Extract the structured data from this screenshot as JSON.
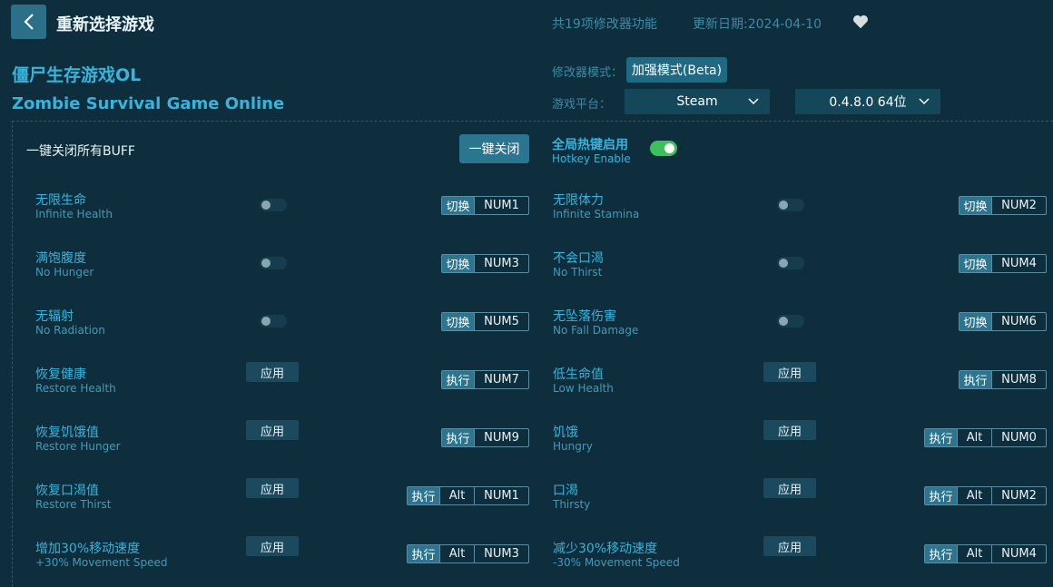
{
  "header": {
    "back_icon": "chevron-left-icon",
    "title": "重新选择游戏",
    "feature_count": "共19项修改器功能",
    "update_date": "更新日期:2024-04-10",
    "favorite_icon": "heart-icon"
  },
  "game": {
    "name_cn": "僵尸生存游戏OL",
    "name_en": "Zombie Survival Game Online"
  },
  "settings": {
    "mode_label": "修改器模式：",
    "mode_value": "加强模式(Beta)",
    "platform_label": "游戏平台：",
    "platform_value": "Steam",
    "version_value": "0.4.8.0 64位"
  },
  "global": {
    "disable_all_label": "一键关闭所有BUFF",
    "disable_all_button": "一键关闭",
    "hotkey_cn": "全局热键启用",
    "hotkey_en": "Hotkey Enable",
    "hotkey_enabled": true
  },
  "labels": {
    "toggle_action": "切换",
    "exec_action": "执行",
    "apply": "应用",
    "alt": "Alt"
  },
  "cheats": [
    {
      "cn": "无限生命",
      "en": "Infinite Health",
      "type": "toggle",
      "keys": [
        "NUM1"
      ]
    },
    {
      "cn": "无限体力",
      "en": "Infinite Stamina",
      "type": "toggle",
      "keys": [
        "NUM2"
      ]
    },
    {
      "cn": "满饱腹度",
      "en": "No Hunger",
      "type": "toggle",
      "keys": [
        "NUM3"
      ]
    },
    {
      "cn": "不会口渴",
      "en": "No Thirst",
      "type": "toggle",
      "keys": [
        "NUM4"
      ]
    },
    {
      "cn": "无辐射",
      "en": "No Radiation",
      "type": "toggle",
      "keys": [
        "NUM5"
      ]
    },
    {
      "cn": "无坠落伤害",
      "en": "No Fall Damage",
      "type": "toggle",
      "keys": [
        "NUM6"
      ]
    },
    {
      "cn": "恢复健康",
      "en": "Restore Health",
      "type": "apply",
      "keys": [
        "NUM7"
      ]
    },
    {
      "cn": "低生命值",
      "en": "Low Health",
      "type": "apply",
      "keys": [
        "NUM8"
      ]
    },
    {
      "cn": "恢复饥饿值",
      "en": "Restore Hunger",
      "type": "apply",
      "keys": [
        "NUM9"
      ]
    },
    {
      "cn": "饥饿",
      "en": "Hungry",
      "type": "apply",
      "keys": [
        "Alt",
        "NUM0"
      ]
    },
    {
      "cn": "恢复口渴值",
      "en": "Restore Thirst",
      "type": "apply",
      "keys": [
        "Alt",
        "NUM1"
      ]
    },
    {
      "cn": "口渴",
      "en": "Thirsty",
      "type": "apply",
      "keys": [
        "Alt",
        "NUM2"
      ]
    },
    {
      "cn": "增加30%移动速度",
      "en": "+30% Movement Speed",
      "type": "apply",
      "keys": [
        "Alt",
        "NUM3"
      ]
    },
    {
      "cn": "减少30%移动速度",
      "en": "-30% Movement Speed",
      "type": "apply",
      "keys": [
        "Alt",
        "NUM4"
      ]
    }
  ]
}
